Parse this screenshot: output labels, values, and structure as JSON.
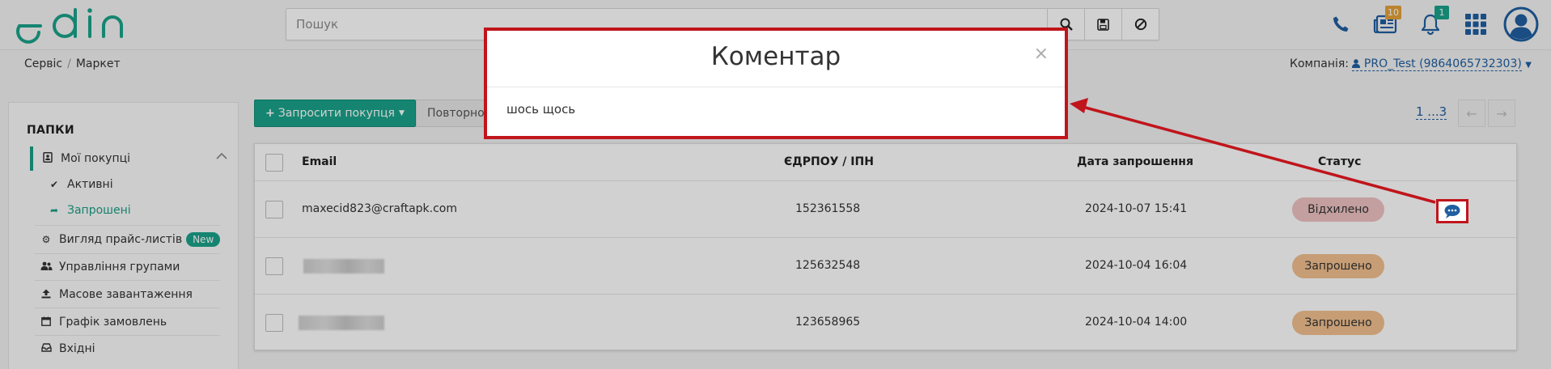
{
  "header": {
    "logo_text": "edin",
    "search_placeholder": "Пошук",
    "icons": [
      "search-icon",
      "save-icon",
      "block-icon",
      "phone-icon",
      "news-icon",
      "bell-icon",
      "apps-grid-icon",
      "user-avatar-icon"
    ],
    "news_badge": "10",
    "notify_badge": "1",
    "colors": {
      "brand": "#1aa38a",
      "news_badge": "#e3a13a",
      "notify_badge": "#1aa38a",
      "icon_blue": "#1f5fa0"
    }
  },
  "breadcrumb": {
    "items": [
      "Сервіс",
      "Маркет"
    ]
  },
  "company": {
    "label": "Компанія:",
    "value": "PRO_Test (9864065732303)"
  },
  "sidebar": {
    "title": "ПАПКИ",
    "items": [
      {
        "label": "Мої покупці",
        "icon": "contacts-icon"
      },
      {
        "label": "Активні",
        "icon": "check-icon"
      },
      {
        "label": "Запрошені",
        "icon": "share-icon"
      },
      {
        "label": "Вигляд прайс-листів",
        "icon": "gear-icon",
        "badge": "New"
      },
      {
        "label": "Управління групами",
        "icon": "users-icon"
      },
      {
        "label": "Масове завантаження",
        "icon": "upload-icon"
      },
      {
        "label": "Графік замовлень",
        "icon": "calendar-icon"
      },
      {
        "label": "Вхідні",
        "icon": "inbox-icon"
      }
    ]
  },
  "toolbar": {
    "invite_label": "Запросити покупця",
    "repeat_label": "Повторно"
  },
  "pagination": {
    "text": "1 ...3"
  },
  "table": {
    "headers": {
      "email": "Email",
      "edrpou": "ЄДРПОУ / ІПН",
      "date": "Дата запрошення",
      "status": "Статус"
    },
    "rows": [
      {
        "email": "maxecid823@craftapk.com",
        "edrpou": "152361558",
        "date": "2024-10-07 15:41",
        "status": "Відхилено",
        "status_color": "#f0c2c2"
      },
      {
        "email": "",
        "edrpou": "125632548",
        "date": "2024-10-04 16:04",
        "status": "Запрошено",
        "status_color": "#f2c08f"
      },
      {
        "email": "",
        "edrpou": "123658965",
        "date": "2024-10-04 14:00",
        "status": "Запрошено",
        "status_color": "#f2c08f"
      }
    ]
  },
  "modal": {
    "title": "Коментар",
    "close": "×",
    "body": "шось щось"
  },
  "annotation_color": "#c0151b"
}
